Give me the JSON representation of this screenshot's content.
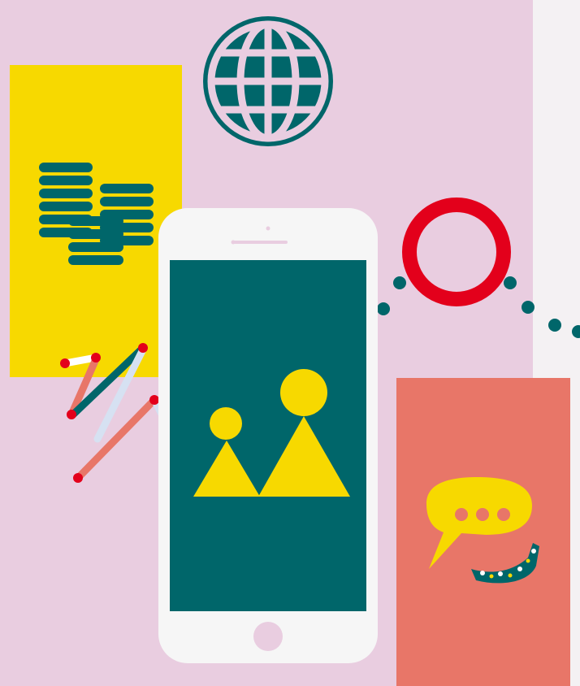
{
  "colors": {
    "background_pink": "#e9cde0",
    "background_white": "#f4f1f3",
    "yellow": "#f7d900",
    "teal": "#00666a",
    "red": "#e3001b",
    "coral": "#e87668",
    "phone_white": "#f6f6f6",
    "phone_button": "#e9cde0",
    "light_blue": "#d6e1f2",
    "dot_white": "#ffffff"
  },
  "icons": {
    "globe": "globe-icon",
    "coins": "coins-icon",
    "ring": "ring-icon",
    "image": "image-icon",
    "chat": "chat-bubble-icon"
  }
}
